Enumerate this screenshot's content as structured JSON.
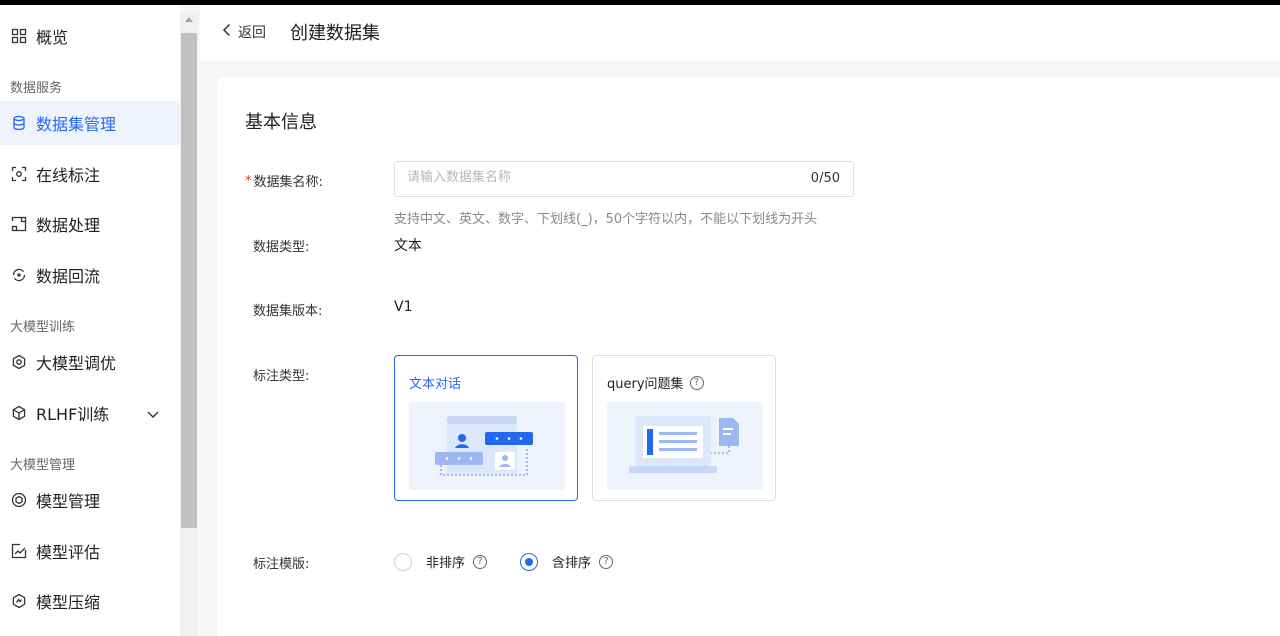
{
  "sidebar": {
    "overview": "概览",
    "sections": {
      "data_service": "数据服务",
      "llm_training": "大模型训练",
      "llm_management": "大模型管理"
    },
    "items": {
      "dataset_mgmt": "数据集管理",
      "online_label": "在线标注",
      "data_process": "数据处理",
      "data_reflow": "数据回流",
      "llm_tuning": "大模型调优",
      "rlhf": "RLHF训练",
      "model_mgmt": "模型管理",
      "model_eval": "模型评估",
      "model_compress": "模型压缩"
    },
    "active": "dataset_mgmt"
  },
  "header": {
    "back": "返回",
    "title": "创建数据集"
  },
  "form": {
    "section_title": "基本信息",
    "name_label": "数据集名称:",
    "name_required_mark": "*",
    "name_placeholder": "请输入数据集名称",
    "name_value": "",
    "name_count": "0/50",
    "name_hint": "支持中文、英文、数字、下划线(_)，50个字符以内，不能以下划线为开头",
    "type_label": "数据类型:",
    "type_value": "文本",
    "version_label": "数据集版本:",
    "version_value": "V1",
    "annot_type_label": "标注类型:",
    "annot_options": [
      {
        "label": "文本对话",
        "selected": true
      },
      {
        "label": "query问题集",
        "selected": false,
        "help": "?"
      }
    ],
    "template_label": "标注模版:",
    "template_options": [
      {
        "label": "非排序",
        "selected": false,
        "help": "?"
      },
      {
        "label": "含排序",
        "selected": true,
        "help": "?"
      }
    ]
  },
  "colors": {
    "accent": "#2468f2",
    "active_bg": "#eef3fd",
    "required": "#e53935"
  }
}
